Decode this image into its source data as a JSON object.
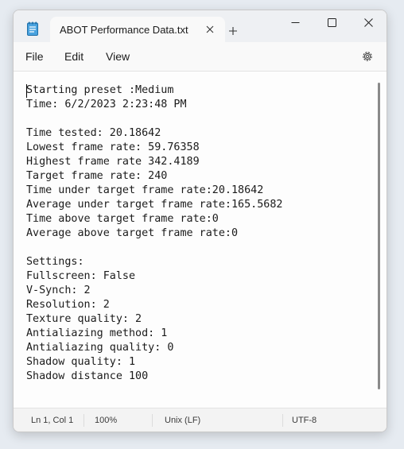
{
  "window": {
    "tab_title": "ABOT Performance Data.txt",
    "app_icon": "notepad-icon",
    "new_tab_icon": "plus-icon",
    "close_tab_icon": "close-icon",
    "controls": [
      "minimize-icon",
      "maximize-icon",
      "close-icon"
    ]
  },
  "menu": {
    "items": [
      "File",
      "Edit",
      "View"
    ],
    "settings_icon": "gear-icon"
  },
  "document": {
    "lines": [
      "Starting preset :Medium",
      "Time: 6/2/2023 2:23:48 PM",
      "",
      "Time tested: 20.18642",
      "Lowest frame rate: 59.76358",
      "Highest frame rate 342.4189",
      "Target frame rate: 240",
      "Time under target frame rate:20.18642",
      "Average under target frame rate:165.5682",
      "Time above target frame rate:0",
      "Average above target frame rate:0",
      "",
      "Settings:",
      "Fullscreen: False",
      "V-Synch: 2",
      "Resolution: 2",
      "Texture quality: 2",
      "Antialiazing method: 1",
      "Antialiazing quality: 0",
      "Shadow quality: 1",
      "Shadow distance 100"
    ]
  },
  "status": {
    "position": "Ln 1, Col 1",
    "zoom": "100%",
    "line_ending": "Unix (LF)",
    "encoding": "UTF-8"
  }
}
